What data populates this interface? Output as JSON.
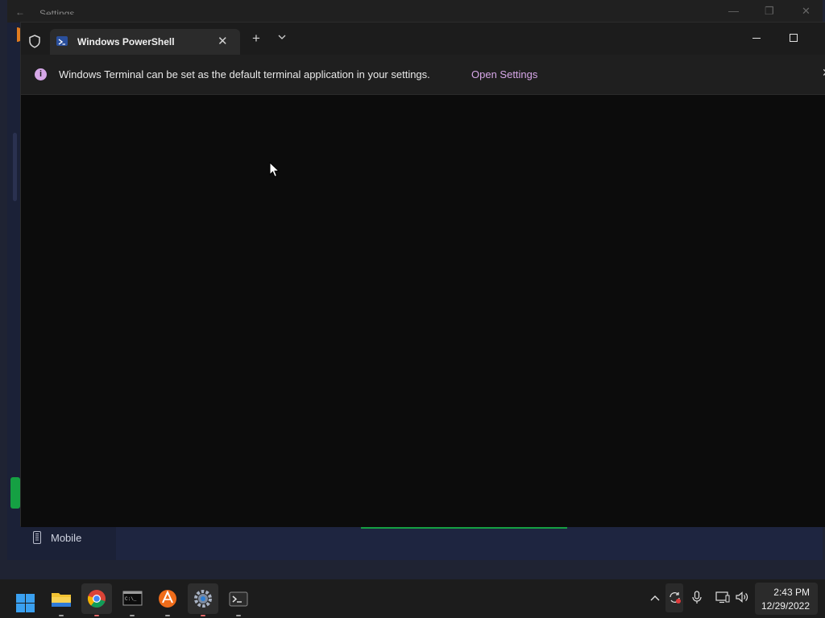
{
  "background_window": {
    "title": "Settings",
    "nav_mobile_label": "Mobile"
  },
  "terminal": {
    "tab_title": "Windows PowerShell",
    "new_tab_label": "+",
    "info_message": "Windows Terminal can be set as the default terminal application in your settings.",
    "info_link": "Open Settings",
    "info_icon_glyph": "i"
  },
  "taskbar": {
    "apps": [
      {
        "name": "start",
        "icon": "windows-logo-icon"
      },
      {
        "name": "file-explorer",
        "icon": "folder-icon"
      },
      {
        "name": "chrome",
        "icon": "chrome-icon"
      },
      {
        "name": "command-prompt",
        "icon": "cmd-icon"
      },
      {
        "name": "app-orange",
        "icon": "orange-app-icon"
      },
      {
        "name": "settings",
        "icon": "gear-icon"
      },
      {
        "name": "terminal",
        "icon": "terminal-icon"
      }
    ],
    "clock": {
      "time": "2:43 PM",
      "date": "12/29/2022"
    }
  },
  "colors": {
    "accent_link": "#d7a7e8",
    "terminal_bg": "#0c0c0c",
    "settings_bg": "#1b2137",
    "green_indicator": "#15a043"
  }
}
